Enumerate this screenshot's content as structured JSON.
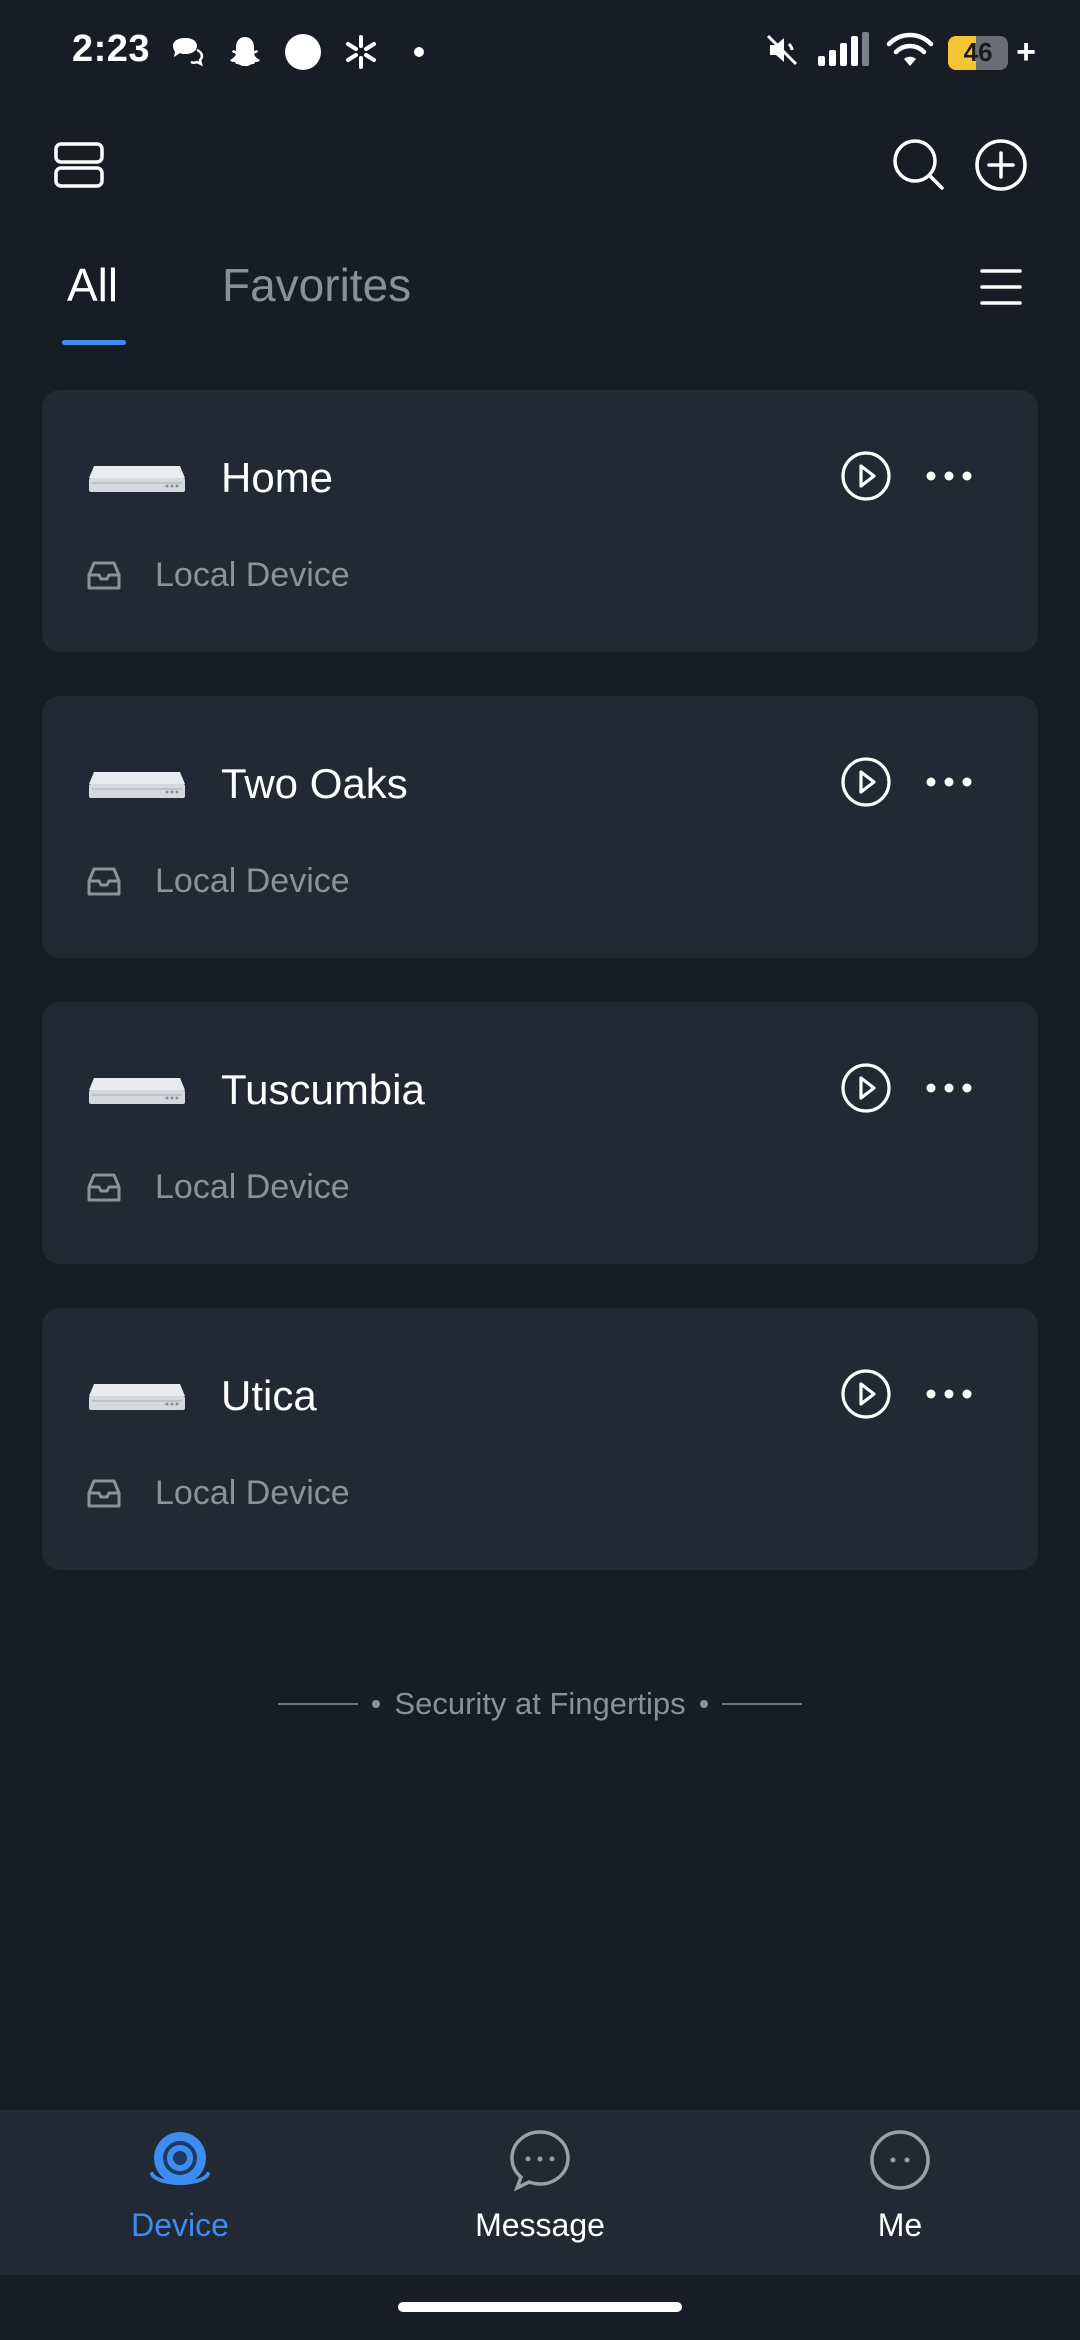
{
  "status_bar": {
    "time": "2:23",
    "battery_level": "46",
    "battery_charging_symbol": "+",
    "left_icons": [
      "chat-bubble-icon",
      "snapchat-ghost-icon",
      "circle-app-icon",
      "walmart-spark-icon",
      "dot-icon"
    ],
    "right_icons": [
      "mute-icon",
      "signal-icon",
      "wifi-icon",
      "battery-icon"
    ],
    "battery_color": "#f3c534"
  },
  "top_bar": {
    "icons": [
      "layout-icon",
      "search-icon",
      "add-icon"
    ]
  },
  "tabs": [
    {
      "label": "All",
      "active": true
    },
    {
      "label": "Favorites",
      "active": false
    }
  ],
  "devices": [
    {
      "name": "Home",
      "subtitle": "Local Device"
    },
    {
      "name": "Two Oaks",
      "subtitle": "Local Device"
    },
    {
      "name": "Tuscumbia",
      "subtitle": "Local Device"
    },
    {
      "name": "Utica",
      "subtitle": "Local Device"
    }
  ],
  "tagline": "Security at Fingertips",
  "bottom_nav": [
    {
      "label": "Device",
      "icon": "device-camera-icon",
      "active": true
    },
    {
      "label": "Message",
      "icon": "message-icon",
      "active": false
    },
    {
      "label": "Me",
      "icon": "me-icon",
      "active": false
    }
  ],
  "colors": {
    "background": "#181c24",
    "card": "#222834",
    "accent": "#3f8cf0",
    "muted_text": "#8c929b"
  }
}
